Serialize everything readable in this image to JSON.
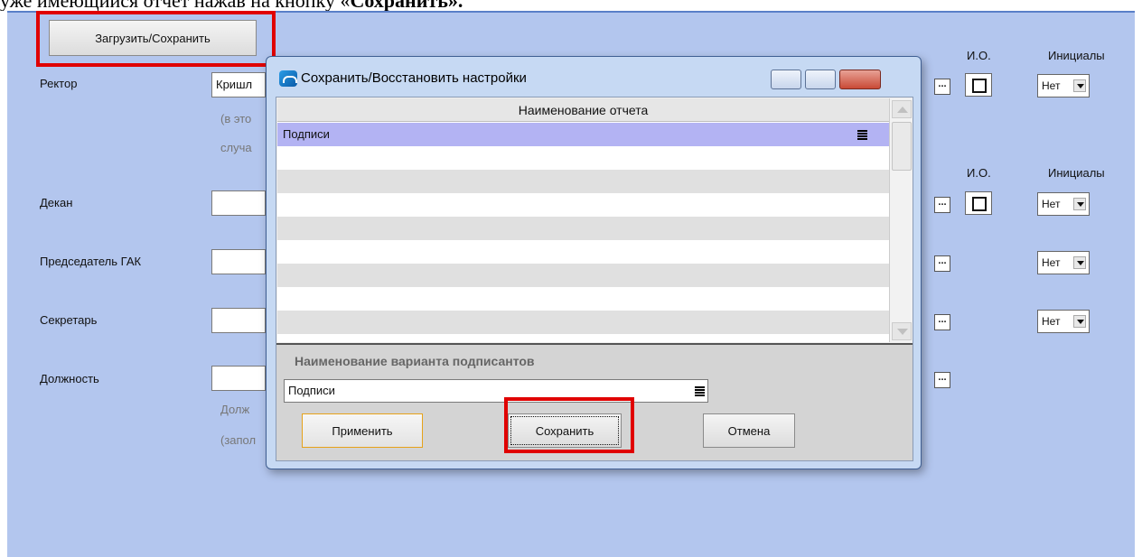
{
  "doc_caption": {
    "prefix": "уже имеющийся отчет нажав на кнопку «",
    "bold": "Сохранить",
    "suffix": "»."
  },
  "form": {
    "load_save_button": "Загрузить/Сохранить",
    "rows": [
      {
        "label": "Ректор",
        "value": "Кришл"
      },
      {
        "label": "Декан",
        "value": ""
      },
      {
        "label": "Председатель ГАК",
        "value": ""
      },
      {
        "label": "Секретарь",
        "value": ""
      },
      {
        "label": "Должность",
        "value": ""
      }
    ],
    "rector_hints": [
      "(в это",
      "случа"
    ],
    "position_hints": [
      "Долж",
      "(запол"
    ],
    "io_header": "И.О.",
    "initials_header": "Инициалы",
    "dots_label": "...",
    "initials_value": "Нет"
  },
  "dialog": {
    "title": "Сохранить/Восстановить настройки",
    "grid_header": "Наименование отчета",
    "grid_rows": [
      "Подписи",
      "",
      "",
      "",
      "",
      "",
      "",
      "",
      ""
    ],
    "variant_label": "Наименование варианта подписантов",
    "variant_value": "Подписи",
    "apply_button": "Применить",
    "save_button": "Сохранить",
    "cancel_button": "Отмена"
  },
  "colors": {
    "panel_bg": "#b3c6ee",
    "highlight": "#e00000",
    "selected_row": "#b3b3f3"
  }
}
